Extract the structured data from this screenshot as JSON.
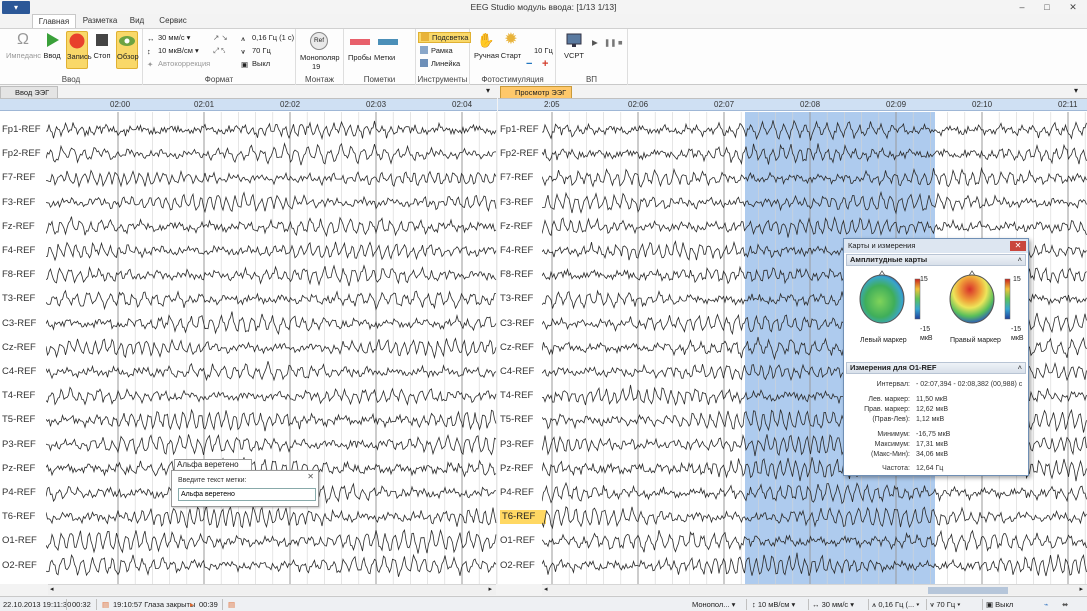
{
  "window": {
    "title": "EEG Studio модуль ввода: [1/13 1/13]",
    "app_button": "▾"
  },
  "tabs": [
    {
      "label": "Главная"
    },
    {
      "label": "Разметка"
    },
    {
      "label": "Вид"
    },
    {
      "label": "Сервис"
    }
  ],
  "ribbon": {
    "groups": {
      "vvod": "Ввод",
      "format": "Формат",
      "montazh": "Монтаж",
      "pometki": "Пометки",
      "instrumenty": "Инструменты",
      "fotostim": "Фотостимуляция",
      "vp": "ВП"
    },
    "buttons": {
      "impedance": "Импеданс",
      "vvod": "Ввод",
      "zapis": "Запись",
      "stop": "Стоп",
      "obzor": "Обзор",
      "speed": "30 мм/с",
      "sens": "10 мкВ/см",
      "autocorr": "Автокоррекция",
      "hf": "0,16 Гц (1 с)",
      "lf": "70 Гц",
      "notch": "Выкл",
      "monopolar": "Монополяр",
      "monopolar_num": "19",
      "ref_badge": "Ref",
      "proby": "Пробы",
      "metki": "Метки",
      "podsvetka": "Подсветка",
      "ramka": "Рамка",
      "lineyka": "Линейка",
      "ruchnaya": "Ручная",
      "start": "Старт",
      "freq10": "10 Гц",
      "vsrt": "VCPT"
    }
  },
  "left_panel": {
    "tab_label": "Ввод ЭЭГ",
    "time_labels": [
      "02:00",
      "02:01",
      "02:02",
      "02:03",
      "02:04"
    ]
  },
  "right_panel": {
    "tab_label": "Просмотр ЭЭГ",
    "time_labels": [
      "2:05",
      "02:06",
      "02:07",
      "02:08",
      "02:09",
      "02:10",
      "02:11"
    ]
  },
  "channels": [
    "Fp1-REF",
    "Fp2-REF",
    "F7-REF",
    "F3-REF",
    "Fz-REF",
    "F4-REF",
    "F8-REF",
    "T3-REF",
    "C3-REF",
    "Cz-REF",
    "C4-REF",
    "T4-REF",
    "T5-REF",
    "P3-REF",
    "Pz-REF",
    "P4-REF",
    "T6-REF",
    "O1-REF",
    "O2-REF"
  ],
  "highlighted_channel": "T6-REF",
  "annotation": {
    "label": "Альфа веретено",
    "dialog_title": "Введите текст метки:",
    "input_value": "Альфа веретено"
  },
  "maps_window": {
    "title": "Карты и измерения",
    "section_maps": "Амплитудные карты",
    "scale_max": "15",
    "scale_min": "-15",
    "scale_unit": "мкВ",
    "left_caption": "Левый маркер",
    "right_caption": "Правый маркер",
    "section_meas": "Измерения для O1-REF",
    "rows": [
      {
        "k": "Интервал:",
        "v": "- 02:07,394 - 02:08,382 (00,988) с"
      },
      {
        "k": "Лев. маркер:",
        "v": "11,50 мкВ"
      },
      {
        "k": "Прав. маркер:",
        "v": "12,62 мкВ"
      },
      {
        "k": "(Прав-Лев):",
        "v": "1,12 мкВ"
      },
      {
        "k": "Минимум:",
        "v": "-16,75 мкВ"
      },
      {
        "k": "Максимум:",
        "v": "17,31 мкВ"
      },
      {
        "k": "(Макс-Мин):",
        "v": "34,06 мкВ"
      },
      {
        "k": "Частота:",
        "v": "12,64 Гц"
      }
    ]
  },
  "status": {
    "datetime": "22.10.2013 19:11:30",
    "elapsed": "00:32",
    "event": "19:10:57 Глаза закрыты",
    "event_dur": "00:39",
    "montage": "Монопол...",
    "sens": "10 мВ/см",
    "speed": "30 мм/с",
    "hf": "0,16 Гц (...",
    "lf": "70 Гц",
    "notch": "Выкл"
  },
  "colors": {
    "accent": "#2b5797",
    "selection": "#aecbee",
    "highlight": "#ffd863",
    "record": "#e8412c"
  }
}
